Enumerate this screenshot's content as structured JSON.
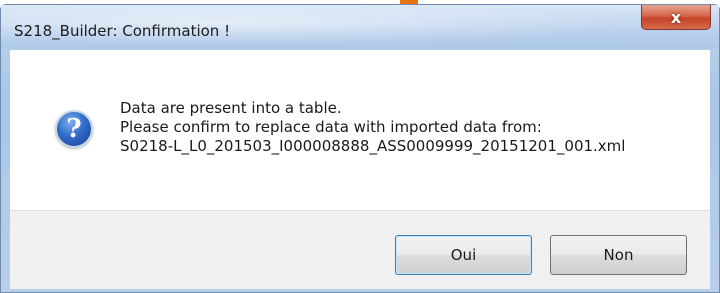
{
  "window": {
    "title": "S218_Builder: Confirmation !",
    "close_glyph": "x"
  },
  "message": {
    "icon": "question-icon",
    "lines": [
      "Data are present into a table.",
      "Please confirm to replace data with imported data from:",
      "S0218-L_L0_201503_I000008888_ASS0009999_20151201_001.xml"
    ]
  },
  "buttons": {
    "yes_label": "Oui",
    "no_label": "Non"
  },
  "colors": {
    "accent": "#e9730f",
    "close_button": "#c4452a",
    "icon_blue": "#2f6cc8"
  }
}
